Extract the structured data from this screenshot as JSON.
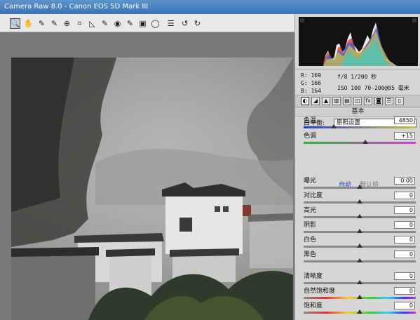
{
  "window": {
    "title": "Camera Raw 8.0 -  Canon EOS 5D Mark III"
  },
  "toolbar": {
    "tools": [
      {
        "name": "zoom-tool-icon",
        "glyph": "🔍",
        "active": true
      },
      {
        "name": "hand-tool-icon",
        "glyph": "✋"
      },
      {
        "name": "white-balance-tool-icon",
        "glyph": "✎"
      },
      {
        "name": "color-sampler-tool-icon",
        "glyph": "✎"
      },
      {
        "name": "targeted-adjustment-tool-icon",
        "glyph": "⊕"
      },
      {
        "name": "crop-tool-icon",
        "glyph": "⌗"
      },
      {
        "name": "straighten-tool-icon",
        "glyph": "◺"
      },
      {
        "name": "spot-removal-tool-icon",
        "glyph": "✎"
      },
      {
        "name": "red-eye-removal-tool-icon",
        "glyph": "◉"
      },
      {
        "name": "adjustment-brush-tool-icon",
        "glyph": "✎"
      },
      {
        "name": "graduated-filter-tool-icon",
        "glyph": "▣"
      },
      {
        "name": "radial-filter-tool-icon",
        "glyph": "◯"
      },
      {
        "name": "preferences-icon",
        "glyph": "☰"
      },
      {
        "name": "rotate-ccw-icon",
        "glyph": "↺"
      },
      {
        "name": "rotate-cw-icon",
        "glyph": "↻"
      }
    ]
  },
  "readout": {
    "r_label": "R:",
    "r_value": "169",
    "g_label": "G:",
    "g_value": "166",
    "b_label": "B:",
    "b_value": "164",
    "exposure_line": "f/8   1/200 秒",
    "iso_line": "ISO 100   70-200@85 毫米"
  },
  "panel": {
    "tabs": [
      {
        "name": "tab-basic",
        "glyph": "◐",
        "active": true
      },
      {
        "name": "tab-tone-curve",
        "glyph": "◢"
      },
      {
        "name": "tab-detail",
        "glyph": "▲"
      },
      {
        "name": "tab-hsl",
        "glyph": "▥"
      },
      {
        "name": "tab-split-toning",
        "glyph": "▤"
      },
      {
        "name": "tab-lens-corrections",
        "glyph": "◫"
      },
      {
        "name": "tab-effects",
        "glyph": "fx"
      },
      {
        "name": "tab-camera-calibration",
        "glyph": "◙"
      },
      {
        "name": "tab-presets",
        "glyph": "☰"
      },
      {
        "name": "tab-snapshots",
        "glyph": "▯"
      }
    ],
    "section_title": "基本",
    "white_balance": {
      "label": "白平衡:",
      "value": "原照设置"
    },
    "auto_label": "自动",
    "default_label": "默认值",
    "sliders": [
      {
        "name": "temperature",
        "label": "色温",
        "value": "4850",
        "pos": 0.27,
        "track": "temp"
      },
      {
        "name": "tint",
        "label": "色调",
        "value": "+15",
        "pos": 0.55,
        "track": "tint"
      },
      {
        "name": "exposure",
        "label": "曝光",
        "value": "0.00",
        "pos": 0.5,
        "track": ""
      },
      {
        "name": "contrast",
        "label": "对比度",
        "value": "0",
        "pos": 0.5,
        "track": ""
      },
      {
        "name": "highlights",
        "label": "高光",
        "value": "0",
        "pos": 0.5,
        "track": ""
      },
      {
        "name": "shadows",
        "label": "阴影",
        "value": "0",
        "pos": 0.5,
        "track": ""
      },
      {
        "name": "whites",
        "label": "白色",
        "value": "0",
        "pos": 0.5,
        "track": ""
      },
      {
        "name": "blacks",
        "label": "黑色",
        "value": "0",
        "pos": 0.5,
        "track": ""
      },
      {
        "name": "clarity",
        "label": "清晰度",
        "value": "0",
        "pos": 0.5,
        "track": ""
      },
      {
        "name": "vibrance",
        "label": "自然饱和度",
        "value": "0",
        "pos": 0.5,
        "track": "sat"
      },
      {
        "name": "saturation",
        "label": "饱和度",
        "value": "0",
        "pos": 0.5,
        "track": "sat"
      }
    ]
  }
}
